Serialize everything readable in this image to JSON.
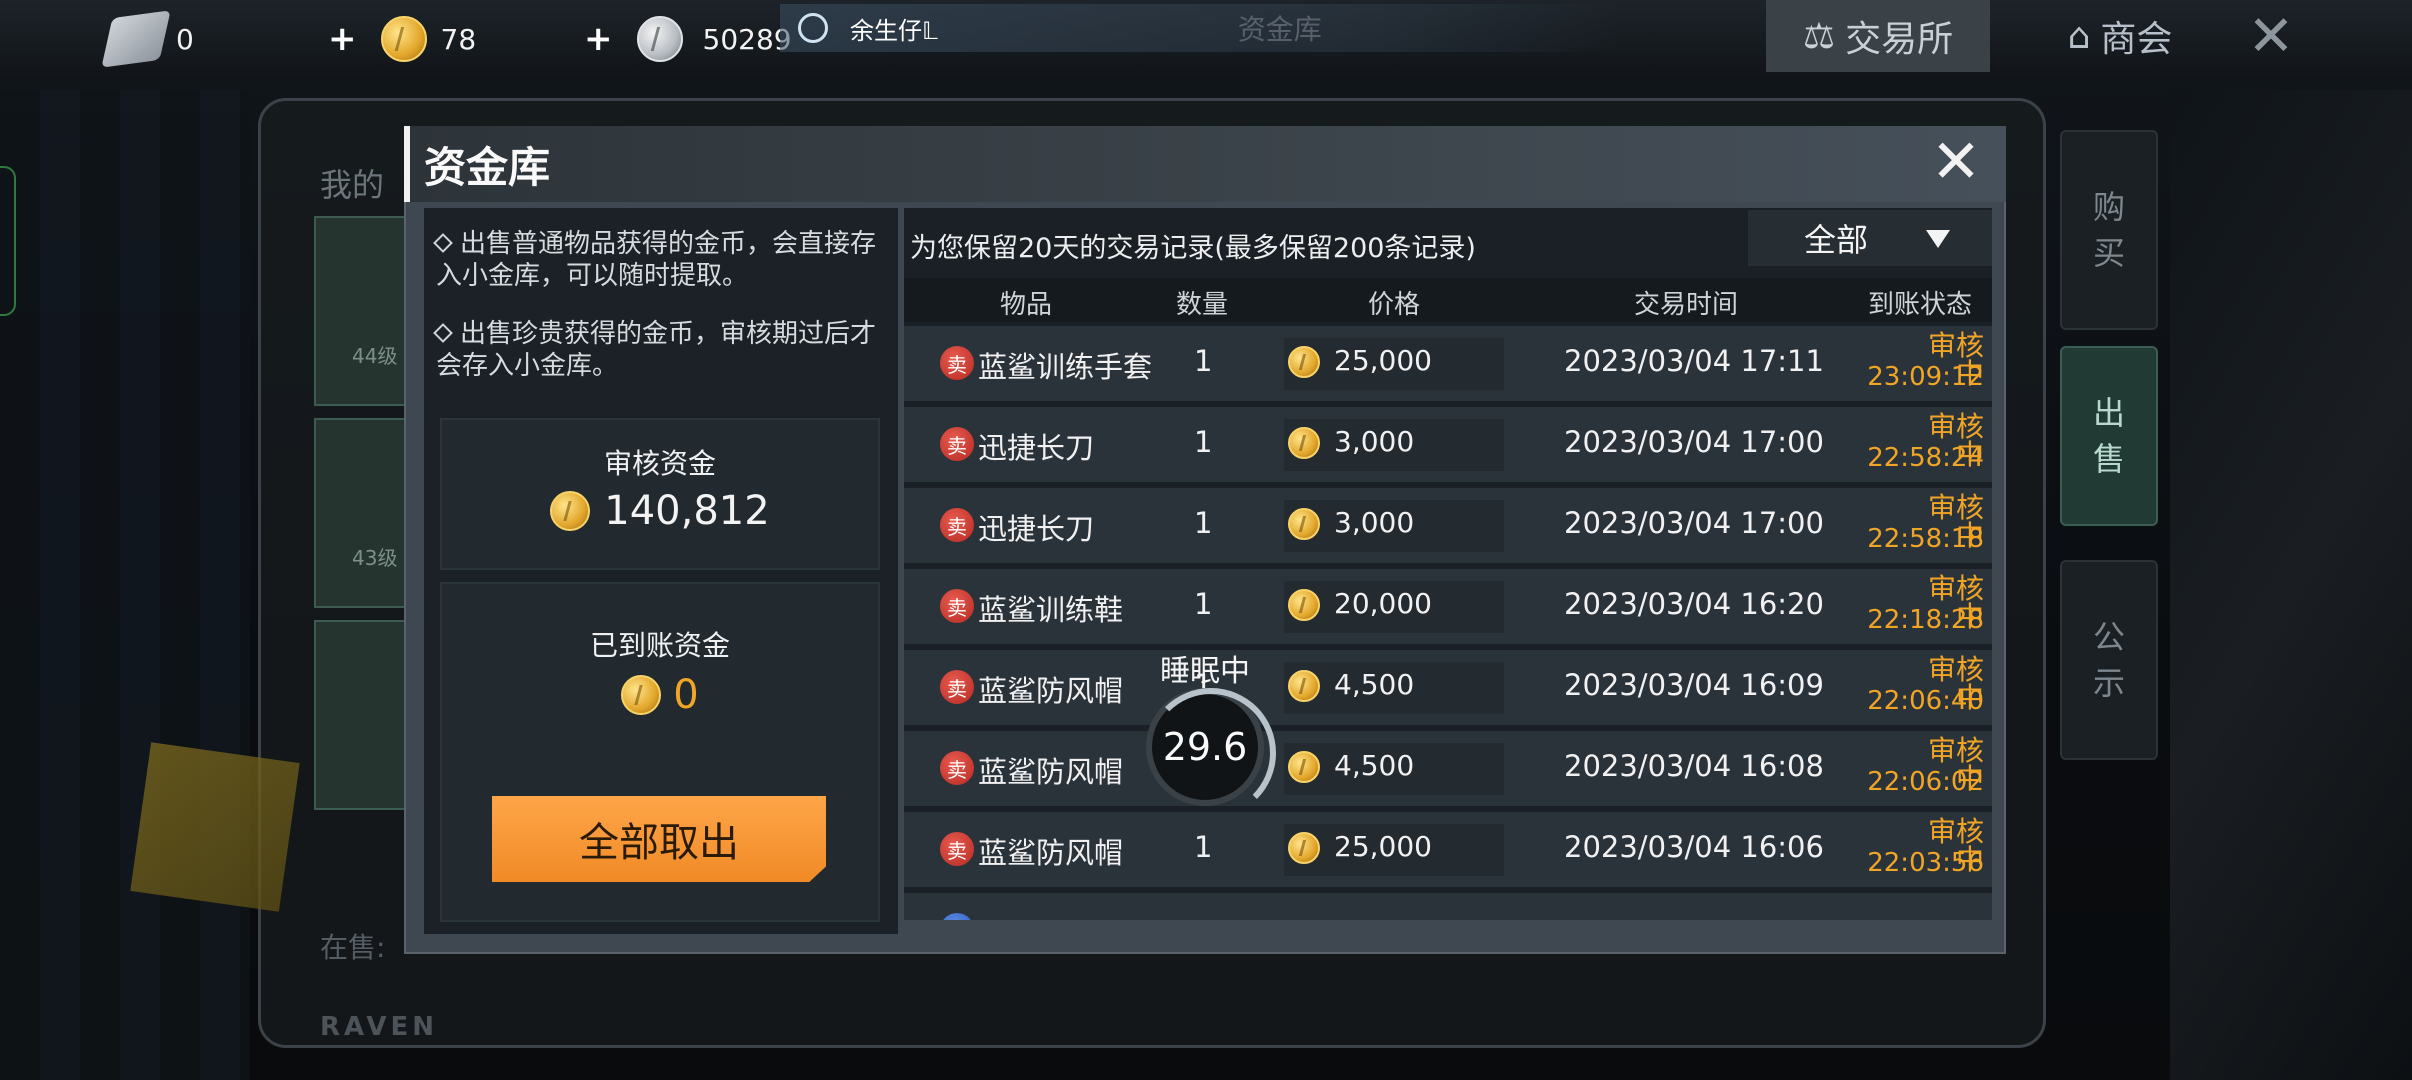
{
  "topbar": {
    "knife_count": "0",
    "gold": "78",
    "silver": "50289",
    "chat_name": "余生仔𝕃",
    "chat_faded": "资金库",
    "exchange_label": "交易所",
    "shop_label": "商会",
    "close_glyph": "✕"
  },
  "side_tabs": {
    "buy": "购\n买",
    "sell": "出\n售",
    "notice": "公\n示"
  },
  "background": {
    "onsale": "在售:",
    "raven": "RAVEN",
    "slot1_lvl": "44级",
    "slot2_lvl": "43级",
    "partial_label": "我的"
  },
  "panel": {
    "title": "资金库",
    "tip1": "出售普通物品获得的金币，会直接存入小金库，可以随时提取。",
    "tip2": "出售珍贵获得的金币，审核期过后才会存入小金库。",
    "review_label": "审核资金",
    "review_value": "140,812",
    "arrived_label": "已到账资金",
    "arrived_value": "0",
    "withdraw_label": "全部取出"
  },
  "records": {
    "title": "为您保留20天的交易记录(最多保留200条记录)",
    "filter": "全部",
    "columns": [
      "物品",
      "数量",
      "价格",
      "交易时间",
      "到账状态"
    ],
    "sell_tag": "卖",
    "rows": [
      {
        "item": "蓝鲨训练手套",
        "qty": "1",
        "price": "25,000",
        "time": "2023/03/04  17:11",
        "status": "审核中",
        "countdown": "23:09:12"
      },
      {
        "item": "迅捷长刀",
        "qty": "1",
        "price": "3,000",
        "time": "2023/03/04  17:00",
        "status": "审核中",
        "countdown": "22:58:24"
      },
      {
        "item": "迅捷长刀",
        "qty": "1",
        "price": "3,000",
        "time": "2023/03/04  17:00",
        "status": "审核中",
        "countdown": "22:58:18"
      },
      {
        "item": "蓝鲨训练鞋",
        "qty": "1",
        "price": "20,000",
        "time": "2023/03/04  16:20",
        "status": "审核中",
        "countdown": "22:18:28"
      },
      {
        "item": "蓝鲨防风帽",
        "qty": "1",
        "price": "4,500",
        "time": "2023/03/04  16:09",
        "status": "审核中",
        "countdown": "22:06:40"
      },
      {
        "item": "蓝鲨防风帽",
        "qty": "1",
        "price": "4,500",
        "time": "2023/03/04  16:08",
        "status": "审核中",
        "countdown": "22:06:02"
      },
      {
        "item": "蓝鲨防风帽",
        "qty": "1",
        "price": "25,000",
        "time": "2023/03/04  16:06",
        "status": "审核中",
        "countdown": "22:03:56"
      }
    ]
  },
  "overlay": {
    "sleep_label": "睡眠中",
    "timer_value": "29.6"
  },
  "colors": {
    "accent_orange": "#f08a26",
    "status_orange": "#f0a526",
    "sell_red": "#b52a22"
  }
}
